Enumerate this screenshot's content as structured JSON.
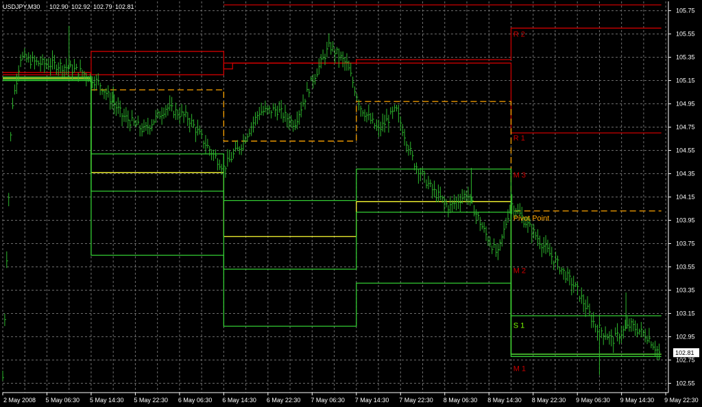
{
  "header": {
    "symbol": "USDJPY,M30",
    "open": "102.90",
    "high": "102.92",
    "low": "102.79",
    "close": "102.81"
  },
  "chart_data": {
    "type": "line",
    "grid": true,
    "price_axis": {
      "range": [
        102.47,
        105.83
      ],
      "ticks": [
        "105.75",
        "105.55",
        "105.35",
        "105.15",
        "104.95",
        "104.75",
        "104.55",
        "104.35",
        "104.15",
        "103.95",
        "103.75",
        "103.55",
        "103.35",
        "103.15",
        "102.95",
        "102.75",
        "102.55"
      ],
      "current_price_label": "102.81"
    },
    "time_axis": {
      "ticks": [
        "2 May 2008",
        "5 May 06:30",
        "5 May 14:30",
        "5 May 22:30",
        "6 May 06:30",
        "6 May 14:30",
        "6 May 22:30",
        "7 May 06:30",
        "7 May 14:30",
        "7 May 22:30",
        "8 May 06:30",
        "8 May 14:30",
        "8 May 22:30",
        "9 May 06:30",
        "9 May 14:30",
        "9 May 22:30"
      ]
    },
    "level_labels": [
      {
        "text": "R 2",
        "price": 105.55,
        "color": "#cc0000"
      },
      {
        "text": "R 1",
        "price": 104.66,
        "color": "#cc0000"
      },
      {
        "text": "M 3",
        "price": 104.34,
        "color": "#cc0000"
      },
      {
        "text": "Pivot Point",
        "price": 103.97,
        "color": "#ffa500"
      },
      {
        "text": "M 2",
        "price": 103.52,
        "color": "#cc0000"
      },
      {
        "text": "S 1",
        "price": 103.05,
        "color": "#7cfc00"
      },
      {
        "text": "M 1",
        "price": 102.68,
        "color": "#cc0000"
      }
    ],
    "session_breaks": [
      0,
      2,
      5,
      8,
      11,
      14
    ],
    "series": [
      {
        "style": "red-solid",
        "color": "#cc0000",
        "steps": [
          [
            0,
            105.2
          ],
          [
            2,
            105.4
          ],
          [
            5,
            105.25
          ],
          [
            5.2,
            105.3
          ],
          [
            11.5,
            104.7
          ]
        ]
      },
      {
        "style": "red-solid",
        "color": "#cc0000",
        "steps": [
          [
            0,
            105.22
          ],
          [
            2,
            105.2
          ],
          [
            5,
            105.3
          ],
          [
            8,
            105.33
          ],
          [
            11.5,
            105.6
          ]
        ]
      },
      {
        "style": "red-solid",
        "color": "#cc0000",
        "steps": [
          [
            5,
            105.8
          ],
          [
            8,
            105.8
          ]
        ]
      },
      {
        "style": "orange-dashed",
        "color": "#ffa500",
        "steps": [
          [
            2,
            105.07
          ],
          [
            5,
            104.63
          ],
          [
            8,
            104.97
          ],
          [
            11.5,
            104.03
          ]
        ]
      },
      {
        "style": "yellow",
        "color": "#ffff33",
        "steps": [
          [
            0,
            105.17
          ],
          [
            2,
            104.36
          ],
          [
            5,
            103.81
          ],
          [
            8,
            104.11
          ],
          [
            11.5,
            102.8
          ]
        ]
      },
      {
        "style": "green",
        "color": "#33cc33",
        "steps": [
          [
            0,
            105.18
          ],
          [
            2,
            104.52
          ],
          [
            5,
            104.12
          ],
          [
            8,
            104.39
          ],
          [
            11.5,
            103.13
          ]
        ]
      },
      {
        "style": "green",
        "color": "#33cc33",
        "steps": [
          [
            0,
            105.16
          ],
          [
            2,
            104.2
          ],
          [
            5,
            103.53
          ],
          [
            8,
            104.02
          ],
          [
            11.5,
            102.78
          ]
        ]
      },
      {
        "style": "green",
        "color": "#33cc33",
        "steps": [
          [
            0,
            105.15
          ],
          [
            2,
            103.65
          ],
          [
            5,
            103.04
          ],
          [
            8,
            103.41
          ],
          [
            11.5,
            102.8
          ]
        ]
      }
    ],
    "price_path": [
      [
        0.0,
        102.6
      ],
      [
        0.2,
        104.9
      ],
      [
        0.4,
        105.35
      ],
      [
        0.8,
        105.3
      ],
      [
        1.3,
        105.28
      ],
      [
        1.8,
        105.22
      ],
      [
        2.2,
        105.12
      ],
      [
        2.7,
        104.85
      ],
      [
        3.2,
        104.72
      ],
      [
        3.7,
        104.92
      ],
      [
        4.2,
        104.83
      ],
      [
        4.6,
        104.6
      ],
      [
        5.0,
        104.4
      ],
      [
        5.4,
        104.6
      ],
      [
        5.8,
        104.88
      ],
      [
        6.2,
        104.9
      ],
      [
        6.6,
        104.78
      ],
      [
        7.0,
        105.15
      ],
      [
        7.4,
        105.45
      ],
      [
        7.8,
        105.28
      ],
      [
        8.1,
        104.92
      ],
      [
        8.5,
        104.72
      ],
      [
        8.9,
        104.9
      ],
      [
        9.3,
        104.45
      ],
      [
        9.7,
        104.22
      ],
      [
        10.1,
        104.06
      ],
      [
        10.5,
        104.18
      ],
      [
        10.9,
        103.85
      ],
      [
        11.2,
        103.65
      ],
      [
        11.5,
        104.1
      ],
      [
        11.8,
        103.95
      ],
      [
        12.2,
        103.75
      ],
      [
        12.6,
        103.55
      ],
      [
        13.0,
        103.35
      ],
      [
        13.4,
        103.05
      ],
      [
        13.8,
        102.92
      ],
      [
        14.2,
        103.05
      ],
      [
        14.6,
        102.95
      ],
      [
        14.85,
        102.81
      ]
    ],
    "spikes": [
      [
        1.5,
        105.62
      ],
      [
        2.5,
        105.1
      ],
      [
        10.6,
        104.4
      ],
      [
        13.5,
        102.62
      ],
      [
        14.1,
        103.33
      ]
    ]
  }
}
